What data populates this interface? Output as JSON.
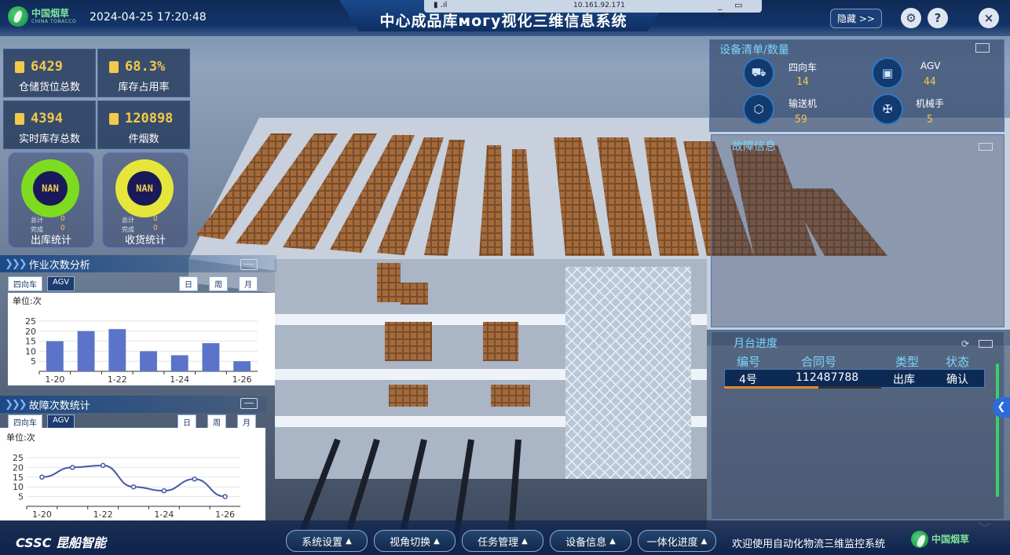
{
  "header": {
    "brand_cn": "中国烟草",
    "brand_en": "CHINA TOBACCO",
    "datetime": "2024-04-25 17:20:48",
    "title": "中心成品库могу视化三维信息系统",
    "remote_ip": "10.161.92.171",
    "hide_label": "隐藏 >>",
    "help_label": "?",
    "close_label": "×"
  },
  "stats": [
    {
      "value": "6429",
      "label": "仓储货位总数"
    },
    {
      "value": "68.3%",
      "label": "库存占用率"
    },
    {
      "value": "4394",
      "label": "实时库存总数"
    },
    {
      "value": "120898",
      "label": "件烟数"
    }
  ],
  "rings": [
    {
      "center": "NAN",
      "total_label": "总计",
      "total": "0",
      "done_label": "完成",
      "done": "0",
      "caption": "出库统计",
      "color": "#7ddc1f"
    },
    {
      "center": "NAN",
      "total_label": "总计",
      "total": "0",
      "done_label": "完成",
      "done": "0",
      "caption": "收货统计",
      "color": "#e6e63a"
    }
  ],
  "panel_ops": {
    "title": "作业次数分析",
    "tabs": [
      "四向车",
      "AGV"
    ],
    "periods": [
      "日",
      "周",
      "月"
    ],
    "unit": "单位:次"
  },
  "panel_fault": {
    "title": "故障次数统计",
    "tabs": [
      "四向车",
      "AGV"
    ],
    "periods": [
      "日",
      "周",
      "月"
    ],
    "unit": "单位:次"
  },
  "chart_data": [
    {
      "type": "bar",
      "categories": [
        "1-20",
        "1-21",
        "1-22",
        "1-23",
        "1-24",
        "1-25",
        "1-26"
      ],
      "tick_labels": [
        "1-20",
        "1-22",
        "1-24",
        "1-26"
      ],
      "values": [
        15,
        20,
        21,
        10,
        8,
        14,
        5
      ],
      "ylabel": "单位:次",
      "yticks": [
        5,
        10,
        15,
        20,
        25
      ],
      "ylim": [
        0,
        25
      ],
      "color": "#5b73c9"
    },
    {
      "type": "line",
      "categories": [
        "1-20",
        "1-21",
        "1-22",
        "1-23",
        "1-24",
        "1-25",
        "1-26"
      ],
      "tick_labels": [
        "1-20",
        "1-22",
        "1-24",
        "1-26"
      ],
      "values": [
        15,
        20,
        21,
        10,
        8,
        14,
        5
      ],
      "ylabel": "单位:次",
      "yticks": [
        5,
        10,
        15,
        20,
        25
      ],
      "ylim": [
        0,
        25
      ],
      "color": "#4458a6"
    }
  ],
  "devices": {
    "title": "设备清单/数量",
    "items": [
      {
        "name": "四向车",
        "value": "14"
      },
      {
        "name": "AGV",
        "value": "44"
      },
      {
        "name": "输送机",
        "value": "59"
      },
      {
        "name": "机械手",
        "value": "5"
      }
    ]
  },
  "faults": {
    "title": "故障信息"
  },
  "platform": {
    "title": "月台进度",
    "columns": [
      "编号",
      "合同号",
      "类型",
      "状态"
    ],
    "rows": [
      {
        "id": "4号",
        "contract": "112487788",
        "type": "出库",
        "status": "确认",
        "progress": 0.6
      }
    ]
  },
  "footer": {
    "brand": "CSSC 昆船智能",
    "nav": [
      "系统设置",
      "视角切换",
      "任务管理",
      "设备信息",
      "一体化进度"
    ],
    "welcome": "欢迎使用自动化物流三维监控系统",
    "brand_right": "中国烟草"
  }
}
